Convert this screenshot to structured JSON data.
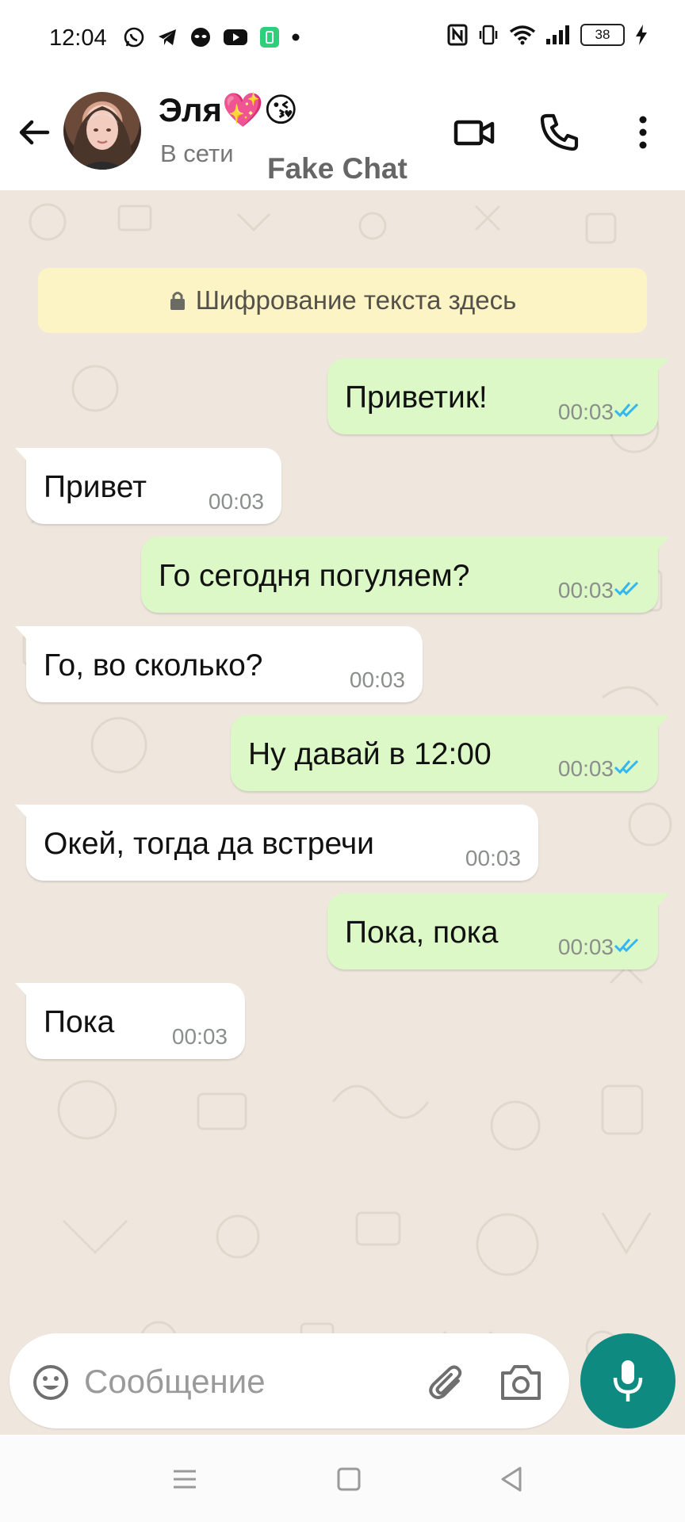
{
  "status_bar": {
    "time": "12:04",
    "battery": "38",
    "left_icons": [
      "whatsapp-icon",
      "telegram-icon",
      "alien-app-icon",
      "youtube-icon",
      "battery-saver-icon",
      "dot-icon"
    ],
    "right_icons": [
      "nfc-icon",
      "vibrate-icon",
      "wifi-icon",
      "signal-icon",
      "battery-icon",
      "charging-icon"
    ]
  },
  "header": {
    "contact_name": "Эля💖😘",
    "status": "В сети",
    "brand": "Fake Chat"
  },
  "chat": {
    "encryption_notice": "Шифрование текста здесь",
    "messages": [
      {
        "direction": "out",
        "text": "Приветик!",
        "time": "00:03",
        "read": true
      },
      {
        "direction": "in",
        "text": "Привет",
        "time": "00:03"
      },
      {
        "direction": "out",
        "text": "Го сегодня погуляем?",
        "time": "00:03",
        "read": true
      },
      {
        "direction": "in",
        "text": "Го, во сколько?",
        "time": "00:03"
      },
      {
        "direction": "out",
        "text": "Ну давай в 12:00",
        "time": "00:03",
        "read": true
      },
      {
        "direction": "in",
        "text": "Окей, тогда да встречи",
        "time": "00:03"
      },
      {
        "direction": "out",
        "text": "Пока, пока",
        "time": "00:03",
        "read": true
      },
      {
        "direction": "in",
        "text": "Пока",
        "time": "00:03"
      }
    ]
  },
  "composer": {
    "placeholder": "Сообщение"
  },
  "colors": {
    "outgoing_bubble": "#dbf8c6",
    "incoming_bubble": "#ffffff",
    "chat_background": "#efe7de",
    "read_ticks": "#34b7f1",
    "mic_button": "#0f8a80",
    "encryption_banner": "#fdf4c5"
  }
}
